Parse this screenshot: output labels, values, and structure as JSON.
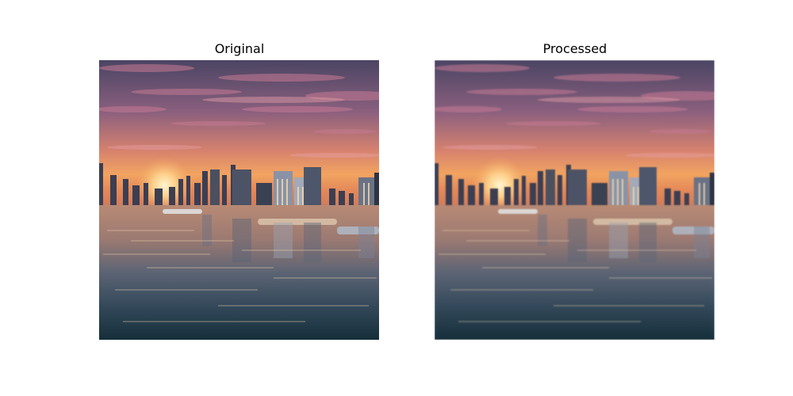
{
  "figure": {
    "panels": [
      {
        "title": "Original"
      },
      {
        "title": "Processed"
      }
    ]
  },
  "image_content": {
    "icon": "city-skyline-at-sunset-over-water",
    "colors": {
      "sky_top": "#4b4663",
      "sky_mid": "#b0677a",
      "horizon_glow": "#f0a25c",
      "sun": "#fff0c0",
      "buildings": "#3a3f52",
      "water_top": "#c39a7a",
      "water_bottom": "#16303c"
    }
  }
}
